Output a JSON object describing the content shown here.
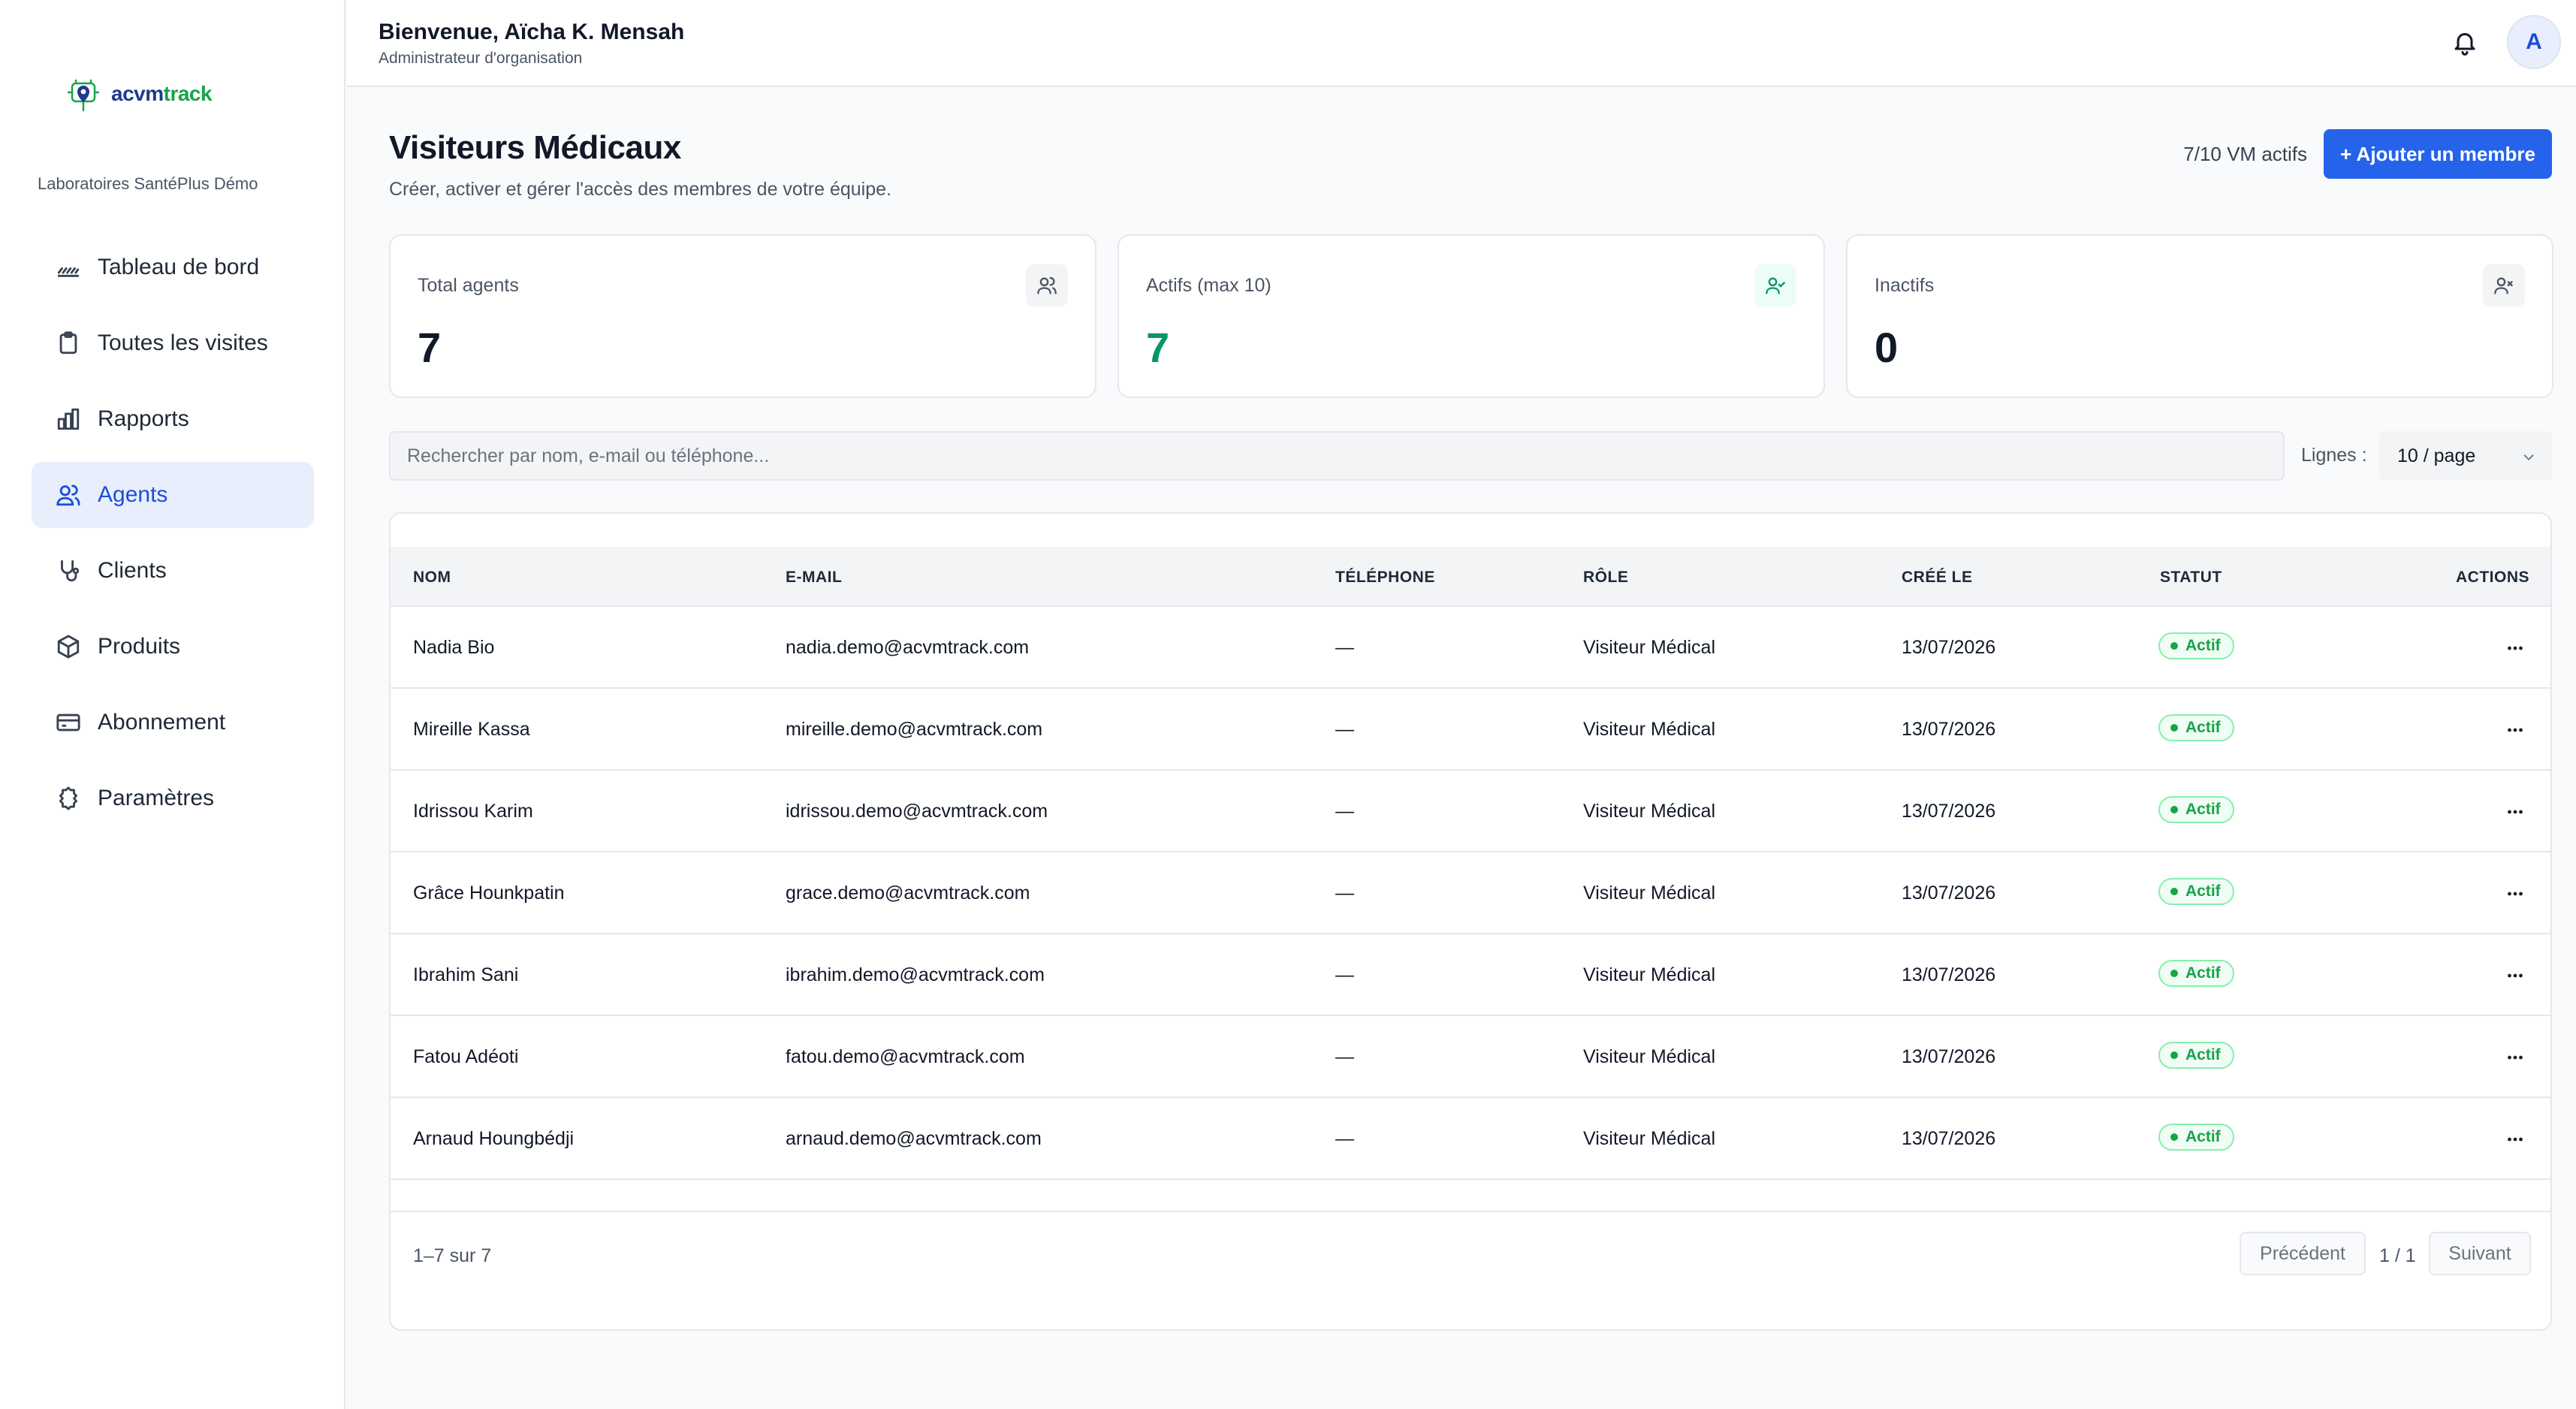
{
  "brand": {
    "logo_part1": "acvm",
    "logo_part2": "track",
    "org_name": "Laboratoires SantéPlus Démo",
    "primary_color": "#2563eb",
    "success_color": "#16a34a"
  },
  "sidebar": {
    "items": [
      {
        "label": "Tableau de bord",
        "icon": "dashboard-icon",
        "active": false
      },
      {
        "label": "Toutes les visites",
        "icon": "clipboard-icon",
        "active": false
      },
      {
        "label": "Rapports",
        "icon": "bar-chart-icon",
        "active": false
      },
      {
        "label": "Agents",
        "icon": "users-icon",
        "active": true
      },
      {
        "label": "Clients",
        "icon": "stethoscope-icon",
        "active": false
      },
      {
        "label": "Produits",
        "icon": "package-icon",
        "active": false
      },
      {
        "label": "Abonnement",
        "icon": "credit-card-icon",
        "active": false
      },
      {
        "label": "Paramètres",
        "icon": "settings-icon",
        "active": false
      }
    ]
  },
  "header": {
    "welcome": "Bienvenue, Aïcha K. Mensah",
    "role": "Administrateur d'organisation",
    "avatar_initial": "A"
  },
  "page": {
    "title": "Visiteurs Médicaux",
    "subtitle": "Créer, activer et gérer l'accès des membres de votre équipe.",
    "vm_count": "7/10 VM actifs",
    "add_button": "+ Ajouter un membre"
  },
  "stats": [
    {
      "label": "Total agents",
      "value": "7",
      "icon": "users-icon"
    },
    {
      "label": "Actifs (max 10)",
      "value": "7",
      "icon": "user-check-icon"
    },
    {
      "label": "Inactifs",
      "value": "0",
      "icon": "user-x-icon"
    }
  ],
  "filters": {
    "search_placeholder": "Rechercher par nom, e-mail ou téléphone...",
    "rows_label": "Lignes :",
    "rows_value": "10 / page"
  },
  "table": {
    "headers": {
      "name": "NOM",
      "email": "E-MAIL",
      "phone": "TÉLÉPHONE",
      "role": "RÔLE",
      "created": "CRÉÉ LE",
      "status": "STATUT",
      "actions": "ACTIONS"
    },
    "rows": [
      {
        "name": "Nadia Bio",
        "email": "nadia.demo@acvmtrack.com",
        "phone": "—",
        "role": "Visiteur Médical",
        "created": "13/07/2026",
        "status": "Actif"
      },
      {
        "name": "Mireille Kassa",
        "email": "mireille.demo@acvmtrack.com",
        "phone": "—",
        "role": "Visiteur Médical",
        "created": "13/07/2026",
        "status": "Actif"
      },
      {
        "name": "Idrissou Karim",
        "email": "idrissou.demo@acvmtrack.com",
        "phone": "—",
        "role": "Visiteur Médical",
        "created": "13/07/2026",
        "status": "Actif"
      },
      {
        "name": "Grâce Hounkpatin",
        "email": "grace.demo@acvmtrack.com",
        "phone": "—",
        "role": "Visiteur Médical",
        "created": "13/07/2026",
        "status": "Actif"
      },
      {
        "name": "Ibrahim Sani",
        "email": "ibrahim.demo@acvmtrack.com",
        "phone": "—",
        "role": "Visiteur Médical",
        "created": "13/07/2026",
        "status": "Actif"
      },
      {
        "name": "Fatou Adéoti",
        "email": "fatou.demo@acvmtrack.com",
        "phone": "—",
        "role": "Visiteur Médical",
        "created": "13/07/2026",
        "status": "Actif"
      },
      {
        "name": "Arnaud Houngbédji",
        "email": "arnaud.demo@acvmtrack.com",
        "phone": "—",
        "role": "Visiteur Médical",
        "created": "13/07/2026",
        "status": "Actif"
      }
    ]
  },
  "pagination": {
    "range": "1–7 sur 7",
    "prev": "Précédent",
    "page": "1 / 1",
    "next": "Suivant"
  }
}
